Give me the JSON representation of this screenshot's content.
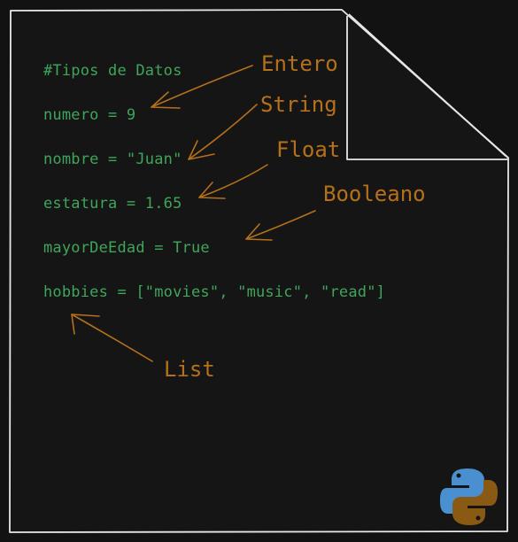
{
  "code": {
    "comment": "#Tipos de Datos",
    "line_numero": "numero = 9",
    "line_nombre": "nombre = \"Juan\"",
    "line_estatura": "estatura = 1.65",
    "line_mayor": "mayorDeEdad = True",
    "line_hobbies": "hobbies = [\"movies\", \"music\", \"read\"]"
  },
  "annotations": {
    "entero": "Entero",
    "string": "String",
    "float": "Float",
    "booleano": "Booleano",
    "list": "List"
  },
  "colors": {
    "background": "#121212",
    "code": "#3fa55a",
    "annotation": "#b5701a",
    "sheet_stroke": "#e6e6e6",
    "python_blue": "#4a8fd0",
    "python_gold": "#8a5a14"
  },
  "icons": {
    "logo": "python-logo-icon"
  }
}
